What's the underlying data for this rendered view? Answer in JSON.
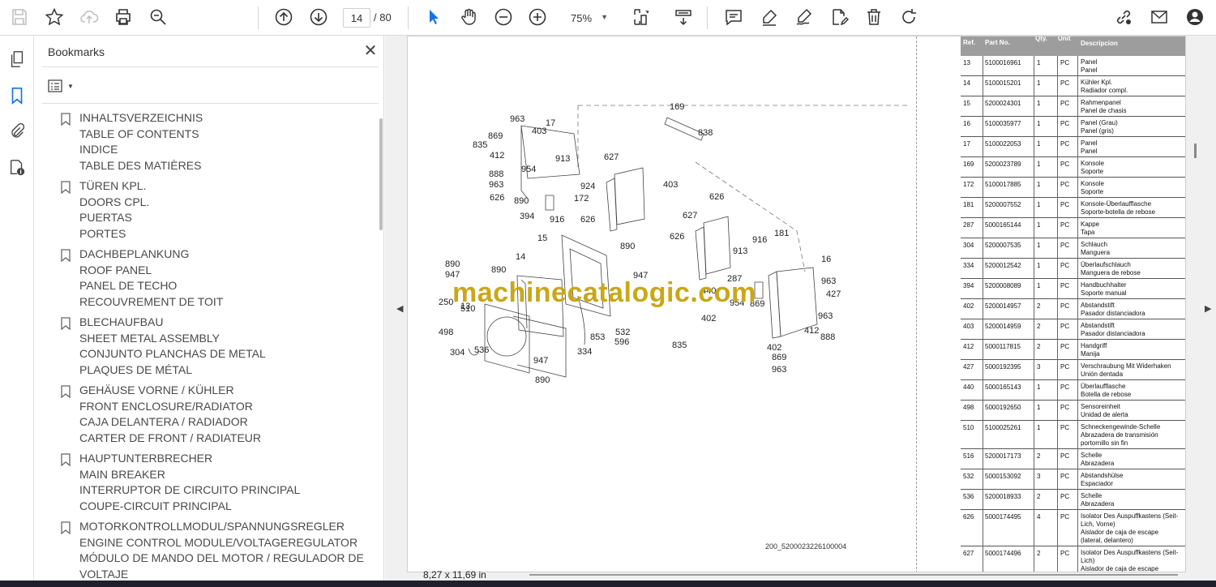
{
  "toolbar": {
    "icons": [
      "save-icon",
      "star-icon",
      "upload-cloud-icon",
      "print-icon",
      "zoom-search-icon",
      "page-up-icon",
      "page-down-icon",
      "select-cursor-icon",
      "hand-icon",
      "zoom-out-icon",
      "zoom-in-icon",
      "fit-page-icon",
      "scroll-mode-icon",
      "comment-icon",
      "highlight-icon",
      "sign-icon",
      "edit-icon",
      "delete-icon",
      "rotate-icon",
      "link-icon",
      "email-icon",
      "account-icon"
    ],
    "page_current": "14",
    "page_total": "/ 80",
    "zoom": "75%"
  },
  "sidebar": {
    "title": "Bookmarks",
    "bookmarks": [
      {
        "lines": [
          "INHALTSVERZEICHNIS",
          "TABLE OF CONTENTS",
          "INDICE",
          "TABLE DES MATIÈRES"
        ]
      },
      {
        "lines": [
          "TÜREN KPL.",
          "DOORS CPL.",
          "PUERTAS",
          "PORTES"
        ]
      },
      {
        "lines": [
          "DACHBEPLANKUNG",
          "ROOF PANEL",
          "PANEL DE TECHO",
          "RECOUVREMENT DE TOIT"
        ]
      },
      {
        "lines": [
          "BLECHAUFBAU",
          "SHEET METAL ASSEMBLY",
          "CONJUNTO PLANCHAS DE METAL",
          "PLAQUES DE MÉTAL"
        ]
      },
      {
        "lines": [
          "GEHÄUSE VORNE / KÜHLER",
          "FRONT ENCLOSURE/RADIATOR",
          "CAJA DELANTERA / RADIADOR",
          "CARTER DE FRONT / RADIATEUR"
        ]
      },
      {
        "lines": [
          "HAUPTUNTERBRECHER",
          "MAIN BREAKER",
          "INTERRUPTOR DE CIRCUITO PRINCIPAL",
          "COUPE-CIRCUIT PRINCIPAL"
        ]
      },
      {
        "lines": [
          "MOTORKONTROLLMODUL/SPANNUNGSREGLER",
          "ENGINE CONTROL MODULE/VOLTAGEREGULATOR",
          "MÓDULO DE MANDO DEL MOTOR / REGULADOR DE",
          "VOLTAJE"
        ]
      }
    ]
  },
  "document": {
    "watermark": "machinecatalogic.com",
    "drawing_code": "200_5200023226100004",
    "page_size": "8,27 x 11,69 in",
    "callouts": [
      "169",
      "838",
      "963",
      "17",
      "869",
      "403",
      "835",
      "412",
      "913",
      "954",
      "627",
      "888",
      "963",
      "924",
      "626",
      "403",
      "890",
      "172",
      "394",
      "916",
      "626",
      "626",
      "627",
      "15",
      "890",
      "626",
      "916",
      "181",
      "890",
      "14",
      "947",
      "913",
      "16",
      "947",
      "890",
      "287",
      "963",
      "13",
      "440",
      "510",
      "954",
      "869",
      "427",
      "250",
      "402",
      "963",
      "498",
      "853",
      "532",
      "412",
      "835",
      "888",
      "304",
      "536",
      "596",
      "334",
      "402",
      "869",
      "947",
      "963",
      "890"
    ],
    "parts_table": {
      "headers": [
        "Ref.",
        "Part No.",
        "Qty.",
        "Unit",
        "Descripcion"
      ],
      "rows": [
        {
          "ref": "13",
          "part": "5100016961",
          "qty": "1",
          "unit": "PC",
          "desc": [
            "Panel",
            "Panel"
          ]
        },
        {
          "ref": "14",
          "part": "5100015201",
          "qty": "1",
          "unit": "PC",
          "desc": [
            "Kühler Kpl.",
            "Radiador compl."
          ]
        },
        {
          "ref": "15",
          "part": "5200024301",
          "qty": "1",
          "unit": "PC",
          "desc": [
            "Rahmenpanel",
            "Panel de chasis"
          ]
        },
        {
          "ref": "16",
          "part": "5100035977",
          "qty": "1",
          "unit": "PC",
          "desc": [
            "Panel (Grau)",
            "Panel (gris)"
          ]
        },
        {
          "ref": "17",
          "part": "5100022053",
          "qty": "1",
          "unit": "PC",
          "desc": [
            "Panel",
            "Panel"
          ]
        },
        {
          "ref": "169",
          "part": "5200023789",
          "qty": "1",
          "unit": "PC",
          "desc": [
            "Konsole",
            "Soporte"
          ]
        },
        {
          "ref": "172",
          "part": "5100017885",
          "qty": "1",
          "unit": "PC",
          "desc": [
            "Konsole",
            "Soporte"
          ]
        },
        {
          "ref": "181",
          "part": "5200007552",
          "qty": "1",
          "unit": "PC",
          "desc": [
            "Konsole-Überlaufflasche",
            "Soporte-botella de rebose"
          ]
        },
        {
          "ref": "287",
          "part": "5000165144",
          "qty": "1",
          "unit": "PC",
          "desc": [
            "Kappe",
            "Tapa"
          ]
        },
        {
          "ref": "304",
          "part": "5200007535",
          "qty": "1",
          "unit": "PC",
          "desc": [
            "Schlauch",
            "Manguera"
          ]
        },
        {
          "ref": "334",
          "part": "5200012542",
          "qty": "1",
          "unit": "PC",
          "desc": [
            "Überlaufschlauch",
            "Manguera de rebose"
          ]
        },
        {
          "ref": "394",
          "part": "5200008089",
          "qty": "1",
          "unit": "PC",
          "desc": [
            "Handbuchhalter",
            "Soporte manual"
          ]
        },
        {
          "ref": "402",
          "part": "5200014957",
          "qty": "2",
          "unit": "PC",
          "desc": [
            "Abstandstift",
            "Pasador distanciadora"
          ]
        },
        {
          "ref": "403",
          "part": "5200014959",
          "qty": "2",
          "unit": "PC",
          "desc": [
            "Abstandstift",
            "Pasador distanciadora"
          ]
        },
        {
          "ref": "412",
          "part": "5000117815",
          "qty": "2",
          "unit": "PC",
          "desc": [
            "Handgriff",
            "Manija"
          ]
        },
        {
          "ref": "427",
          "part": "5000192395",
          "qty": "3",
          "unit": "PC",
          "desc": [
            "Verschraubung Mit Widerhaken",
            "Unión dentada"
          ]
        },
        {
          "ref": "440",
          "part": "5000165143",
          "qty": "1",
          "unit": "PC",
          "desc": [
            "Überlaufflasche",
            "Botella de rebose"
          ]
        },
        {
          "ref": "498",
          "part": "5000192650",
          "qty": "1",
          "unit": "PC",
          "desc": [
            "Sensoreinheit",
            "Unidad de alerta"
          ]
        },
        {
          "ref": "510",
          "part": "5100025261",
          "qty": "1",
          "unit": "PC",
          "desc": [
            "Schneckengewinde-Schelle",
            "Abrazadera de transmisión",
            "portornillo sin fin"
          ]
        },
        {
          "ref": "516",
          "part": "5200017173",
          "qty": "2",
          "unit": "PC",
          "desc": [
            "Schelle",
            "Abrazadera"
          ]
        },
        {
          "ref": "532",
          "part": "5000153092",
          "qty": "3",
          "unit": "PC",
          "desc": [
            "Abstandshülse",
            "Espaciador"
          ]
        },
        {
          "ref": "536",
          "part": "5200018933",
          "qty": "2",
          "unit": "PC",
          "desc": [
            "Schelle",
            "Abrazadera"
          ]
        },
        {
          "ref": "626",
          "part": "5000174495",
          "qty": "4",
          "unit": "PC",
          "desc": [
            "Isolator Des Auspuffkastens (Seit-",
            "Lich, Vorne)",
            "Aislador de caja de escape",
            "(lateral, delantero)"
          ]
        },
        {
          "ref": "627",
          "part": "5000174496",
          "qty": "2",
          "unit": "PC",
          "desc": [
            "Isolator Des Auspuffkastens (Seit-",
            "Lich)",
            "Aislador de caja de escape"
          ]
        }
      ]
    }
  }
}
